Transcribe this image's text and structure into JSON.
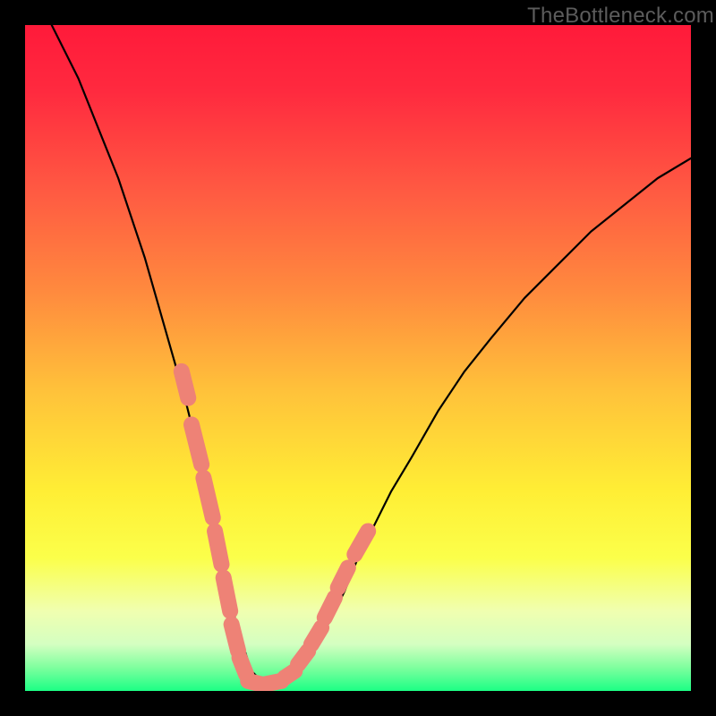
{
  "watermark": "TheBottleneck.com",
  "colors": {
    "background": "#000000",
    "gradient_stops": [
      {
        "offset": 0.0,
        "color": "#ff1a3a"
      },
      {
        "offset": 0.1,
        "color": "#ff2a3f"
      },
      {
        "offset": 0.25,
        "color": "#ff5a42"
      },
      {
        "offset": 0.4,
        "color": "#ff8a3e"
      },
      {
        "offset": 0.55,
        "color": "#ffc23a"
      },
      {
        "offset": 0.7,
        "color": "#ffee35"
      },
      {
        "offset": 0.8,
        "color": "#fbff4a"
      },
      {
        "offset": 0.88,
        "color": "#f0ffb0"
      },
      {
        "offset": 0.93,
        "color": "#d4ffc1"
      },
      {
        "offset": 0.965,
        "color": "#7eff9e"
      },
      {
        "offset": 1.0,
        "color": "#1cff85"
      }
    ],
    "curve": "#000000",
    "marker": "#ee8276"
  },
  "chart_data": {
    "type": "line",
    "title": "",
    "xlabel": "",
    "ylabel": "",
    "xlim": [
      0,
      100
    ],
    "ylim": [
      0,
      100
    ],
    "grid": false,
    "legend": null,
    "series": [
      {
        "name": "bottleneck-curve",
        "x": [
          4,
          6,
          8,
          10,
          12,
          14,
          16,
          18,
          20,
          22,
          24,
          26,
          28,
          29,
          30,
          31,
          32,
          33,
          34,
          35,
          36,
          37,
          38,
          40,
          42,
          44,
          46,
          48,
          50,
          52,
          55,
          58,
          62,
          66,
          70,
          75,
          80,
          85,
          90,
          95,
          100
        ],
        "y": [
          100,
          96,
          92,
          87,
          82,
          77,
          71,
          65,
          58,
          51,
          44,
          36,
          28,
          23,
          18,
          13,
          9,
          6,
          3,
          2,
          1,
          1,
          1,
          2,
          4,
          7,
          11,
          15,
          20,
          24,
          30,
          35,
          42,
          48,
          53,
          59,
          64,
          69,
          73,
          77,
          80
        ]
      }
    ],
    "markers": {
      "name": "highlight-dashes",
      "note": "short thick salmon dash segments overlaid near the valley on both limbs",
      "segments": [
        {
          "x": [
            23.5,
            24.5
          ],
          "y": [
            48,
            44
          ]
        },
        {
          "x": [
            25.0,
            26.5
          ],
          "y": [
            40,
            34
          ]
        },
        {
          "x": [
            26.8,
            28.2
          ],
          "y": [
            32,
            26
          ]
        },
        {
          "x": [
            28.5,
            29.5
          ],
          "y": [
            24,
            19
          ]
        },
        {
          "x": [
            29.8,
            30.8
          ],
          "y": [
            17,
            12
          ]
        },
        {
          "x": [
            31.0,
            32.0
          ],
          "y": [
            10,
            6
          ]
        },
        {
          "x": [
            32.2,
            33.2
          ],
          "y": [
            5,
            2.5
          ]
        },
        {
          "x": [
            33.5,
            35.5
          ],
          "y": [
            1.5,
            1
          ]
        },
        {
          "x": [
            36.0,
            38.5
          ],
          "y": [
            1,
            1.5
          ]
        },
        {
          "x": [
            39.0,
            40.5
          ],
          "y": [
            2,
            3
          ]
        },
        {
          "x": [
            41.0,
            42.5
          ],
          "y": [
            4,
            6
          ]
        },
        {
          "x": [
            43.0,
            44.5
          ],
          "y": [
            7,
            9.5
          ]
        },
        {
          "x": [
            45.0,
            46.5
          ],
          "y": [
            11,
            14
          ]
        },
        {
          "x": [
            47.0,
            48.5
          ],
          "y": [
            15.5,
            18.5
          ]
        },
        {
          "x": [
            49.5,
            51.5
          ],
          "y": [
            20.5,
            24
          ]
        }
      ]
    }
  }
}
